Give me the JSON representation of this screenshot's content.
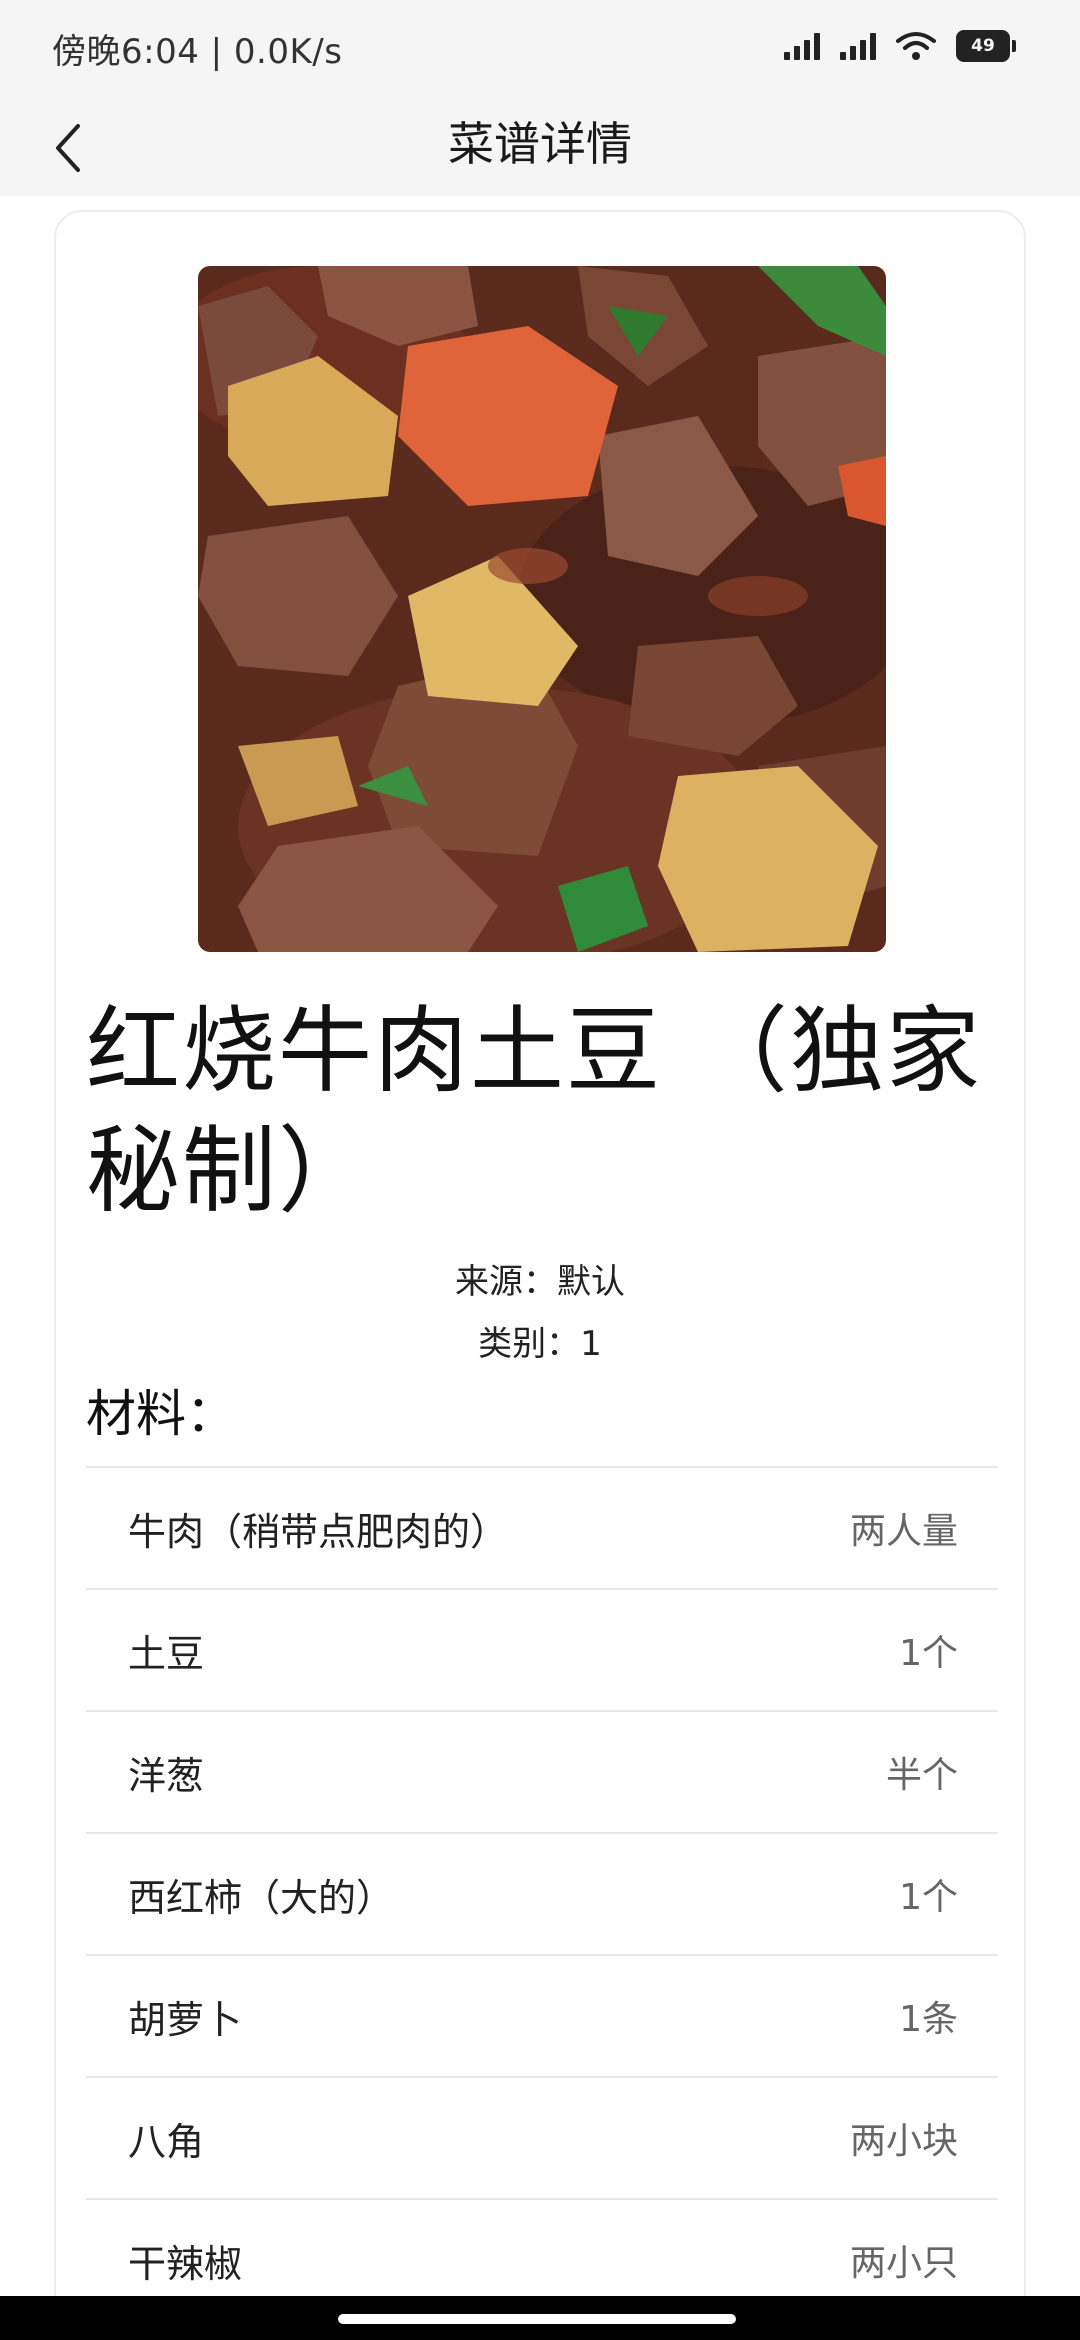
{
  "status_bar": {
    "time": "傍晚6:04 | 0.0K/s",
    "battery": "49",
    "icons": [
      "signal-icon",
      "signal-icon",
      "wifi-icon",
      "battery-icon"
    ]
  },
  "app_bar": {
    "back_icon": "chevron-left-icon",
    "title": "菜谱详情"
  },
  "recipe": {
    "image": "braised-beef-potato-photo",
    "title": "红烧牛肉土豆 （独家秘制）",
    "source": "来源：默认",
    "category": "类别：1",
    "materials_label": "材料：",
    "ingredients": [
      {
        "name": "牛肉（稍带点肥肉的）",
        "amount": "两人量"
      },
      {
        "name": "土豆",
        "amount": "1个"
      },
      {
        "name": "洋葱",
        "amount": "半个"
      },
      {
        "name": "西红柿（大的）",
        "amount": "1个"
      },
      {
        "name": "胡萝卜",
        "amount": "1条"
      },
      {
        "name": "八角",
        "amount": "两小块"
      },
      {
        "name": "干辣椒",
        "amount": "两小只"
      }
    ]
  },
  "colors": {
    "background": "#f5f5f5",
    "card": "#ffffff",
    "divider": "#e8e8e8",
    "text": "#1a1a1a",
    "secondary_text": "#666666"
  }
}
